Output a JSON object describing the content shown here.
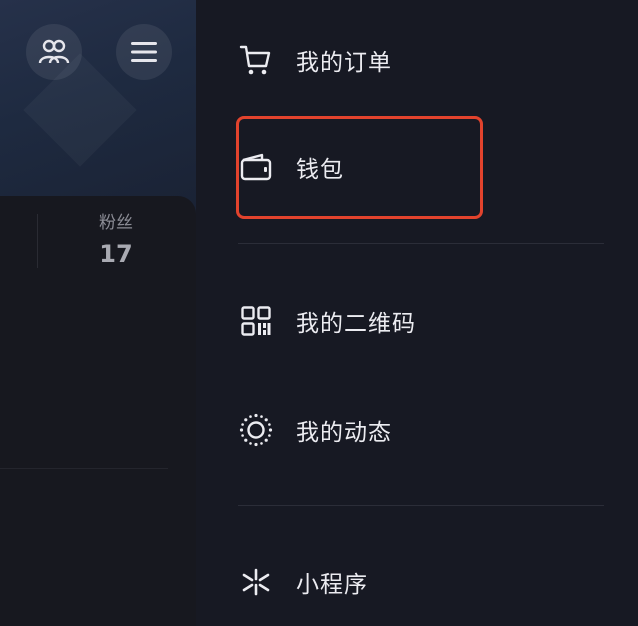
{
  "background_page": {
    "stats": {
      "fans_label": "粉丝",
      "fans_value": "17"
    },
    "icons": {
      "friends": "friends-icon",
      "menu": "hamburger-menu-icon"
    }
  },
  "drawer": {
    "items": [
      {
        "label": "我的订单",
        "icon": "cart-icon"
      },
      {
        "label": "钱包",
        "icon": "wallet-icon"
      },
      {
        "label": "我的二维码",
        "icon": "qrcode-icon"
      },
      {
        "label": "我的动态",
        "icon": "sun-icon"
      },
      {
        "label": "小程序",
        "icon": "mini-program-icon"
      }
    ]
  },
  "colors": {
    "drawer_bg": "#171923",
    "highlight": "#e2432d",
    "text": "#ececf1"
  }
}
